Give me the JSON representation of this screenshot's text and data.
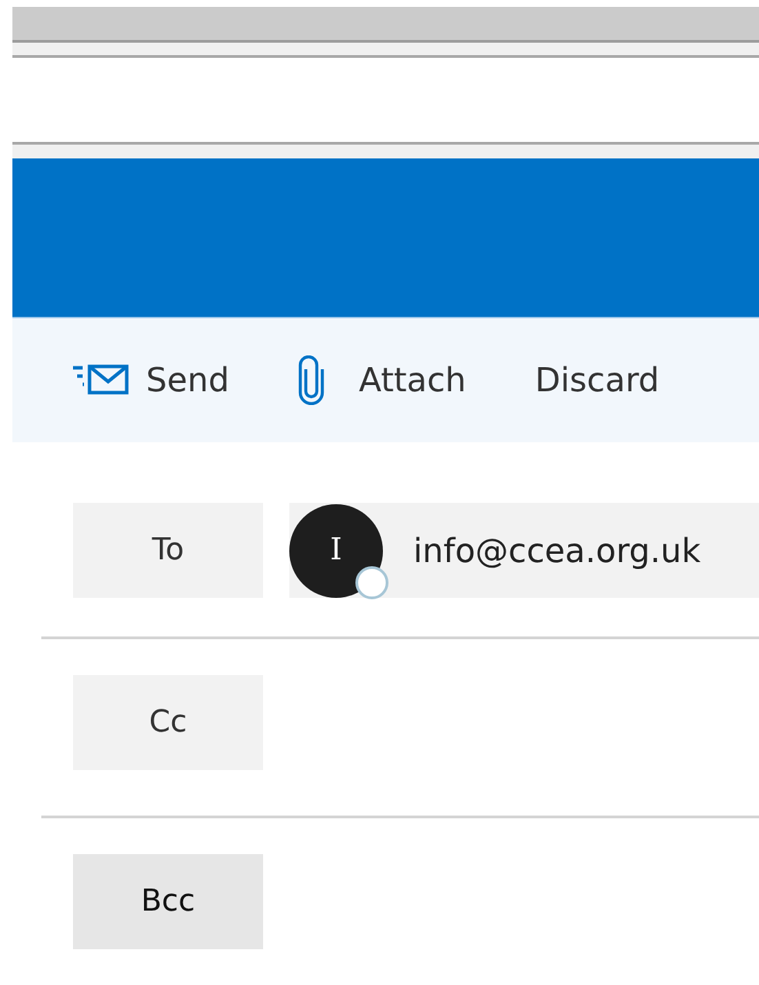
{
  "toolbar": [
    {
      "kind": "send",
      "label": "Send"
    },
    {
      "kind": "attach",
      "label": "Attach"
    },
    {
      "kind": "discard",
      "label": "Discard"
    }
  ],
  "fields": [
    {
      "label": "To",
      "highlighted": false,
      "recipients": [
        {
          "initial": "I",
          "address": "info@ccea.org.uk"
        }
      ]
    },
    {
      "label": "Cc",
      "highlighted": false
    },
    {
      "label": "Bcc",
      "highlighted": true
    }
  ]
}
